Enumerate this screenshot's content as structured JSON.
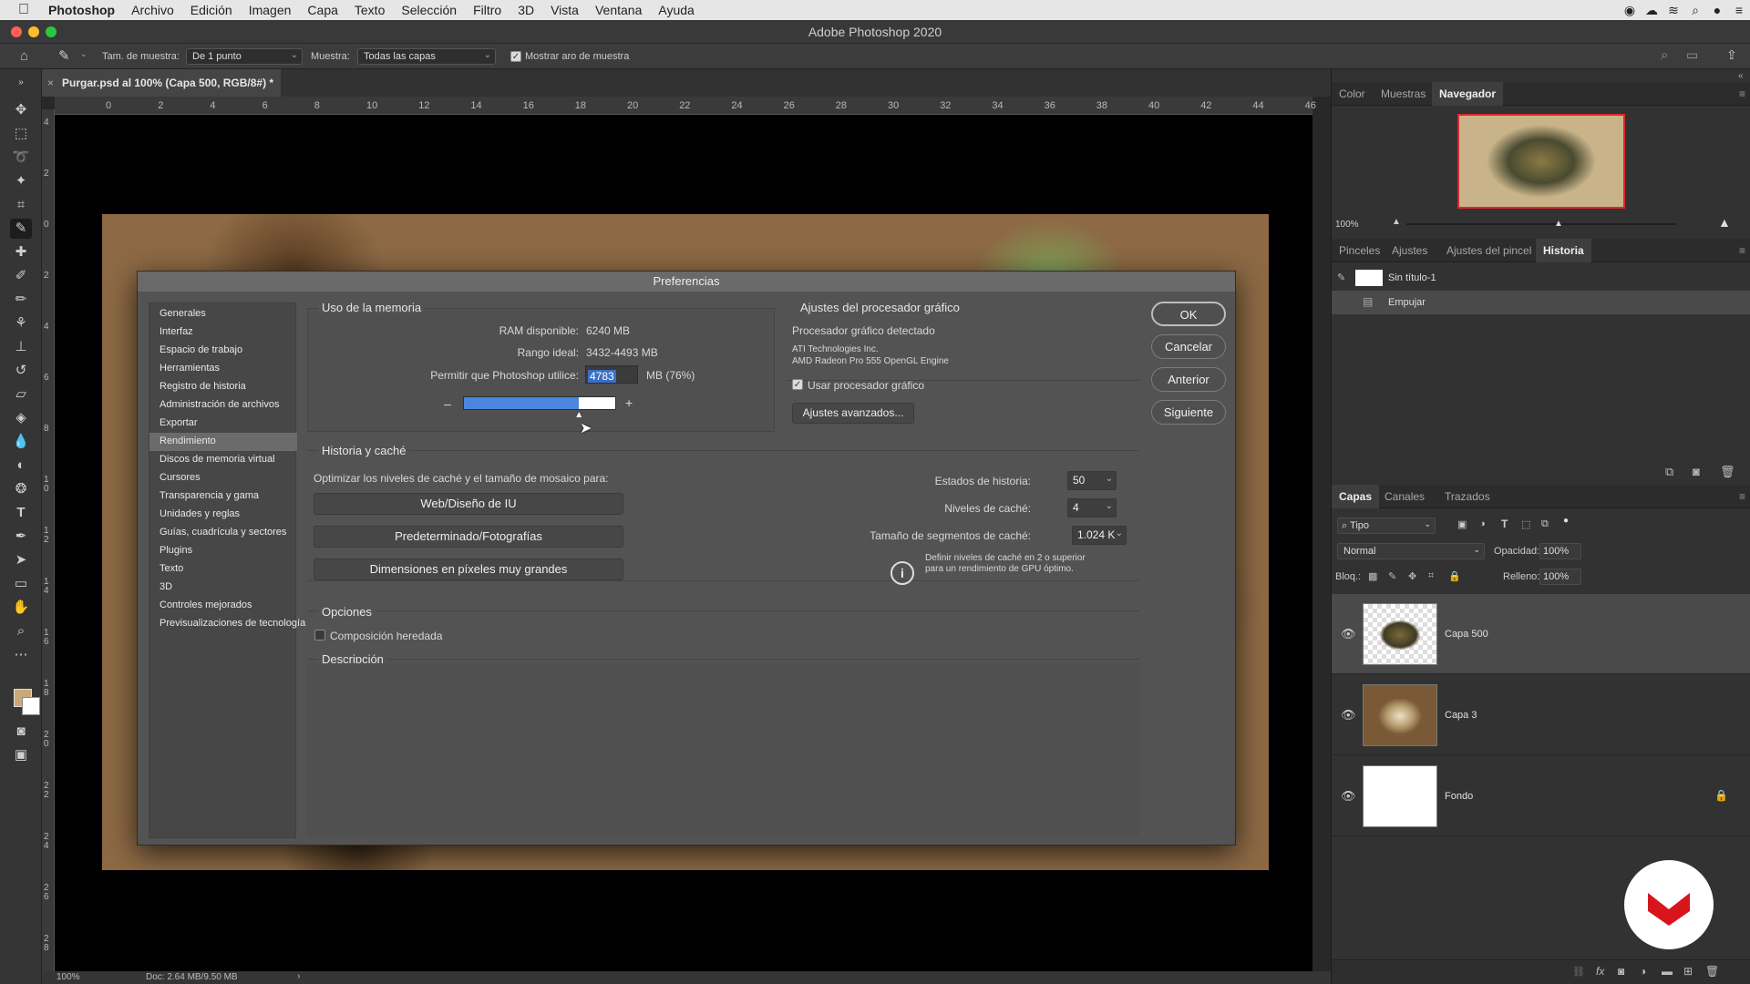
{
  "menubar": {
    "app": "Photoshop",
    "items": [
      "Archivo",
      "Edición",
      "Imagen",
      "Capa",
      "Texto",
      "Selección",
      "Filtro",
      "3D",
      "Vista",
      "Ventana",
      "Ayuda"
    ]
  },
  "window": {
    "title": "Adobe Photoshop 2020"
  },
  "options": {
    "sample_size_label": "Tam. de muestra:",
    "sample_size_value": "De 1 punto",
    "sample_label": "Muestra:",
    "sample_value": "Todas las capas",
    "show_ring_label": "Mostrar aro de muestra"
  },
  "document": {
    "tab": "Purgar.psd al 100% (Capa 500, RGB/8#) *",
    "ruler_h": [
      "0",
      "2",
      "4",
      "6",
      "8",
      "10",
      "12",
      "14",
      "16",
      "18",
      "20",
      "22",
      "24",
      "26",
      "28",
      "30",
      "32",
      "34",
      "36",
      "38",
      "40",
      "42",
      "44",
      "46"
    ],
    "ruler_v": [
      "4",
      "2",
      "0",
      "2",
      "4",
      "6",
      "8",
      "1 0",
      "1 2",
      "1 4",
      "1 6",
      "1 8",
      "2 0",
      "2 2",
      "2 4",
      "2 6",
      "2 8"
    ],
    "zoom": "100%",
    "doc_info": "Doc: 2.64 MB/9.50 MB"
  },
  "dialog": {
    "title": "Preferencias",
    "nav": [
      "Generales",
      "Interfaz",
      "Espacio de trabajo",
      "Herramientas",
      "Registro de historia",
      "Administración de archivos",
      "Exportar",
      "Rendimiento",
      "Discos de memoria virtual",
      "Cursores",
      "Transparencia y gama",
      "Unidades y reglas",
      "Guías, cuadrícula y sectores",
      "Plugins",
      "Texto",
      "3D",
      "Controles mejorados",
      "Previsualizaciones de tecnología"
    ],
    "selected_nav": "Rendimiento",
    "memory": {
      "title": "Uso de la memoria",
      "ram_label": "RAM disponible:",
      "ram_value": "6240 MB",
      "ideal_label": "Rango ideal:",
      "ideal_value": "3432-4493 MB",
      "allow_label": "Permitir que Photoshop utilice:",
      "allow_value": "4783",
      "allow_unit": "MB (76%)",
      "slider_fraction": 0.76,
      "minus": "–",
      "plus": "+"
    },
    "gpu": {
      "title": "Ajustes del procesador gráfico",
      "detected_label": "Procesador gráfico detectado",
      "vendor": "ATI Technologies Inc.",
      "engine": "AMD Radeon Pro 555 OpenGL Engine",
      "use_gpu_label": "Usar procesador gráfico",
      "advanced_button": "Ajustes avanzados..."
    },
    "history": {
      "title": "Historia y caché",
      "optimize_label": "Optimizar los niveles de caché y el tamaño de mosaico para:",
      "buttons": [
        "Web/Diseño de IU",
        "Predeterminado/Fotografías",
        "Dimensiones en píxeles muy grandes"
      ],
      "states_label": "Estados de historia:",
      "states_value": "50",
      "levels_label": "Niveles de caché:",
      "levels_value": "4",
      "tile_label": "Tamaño de segmentos de caché:",
      "tile_value": "1.024 K",
      "info": "Definir niveles de caché en 2 o superior para un rendimiento de GPU óptimo."
    },
    "options": {
      "title": "Opciones",
      "legacy_label": "Composición heredada"
    },
    "description": {
      "title": "Descripción"
    },
    "buttons": {
      "ok": "OK",
      "cancel": "Cancelar",
      "prev": "Anterior",
      "next": "Siguiente"
    }
  },
  "panels": {
    "top_tabs": [
      "Color",
      "Muestras",
      "Navegador"
    ],
    "nav_zoom": "100%",
    "mid_tabs": [
      "Pinceles",
      "Ajustes",
      "Ajustes del pincel",
      "Historia"
    ],
    "history_items": [
      "Sin título-1",
      "Empujar"
    ],
    "layer_tabs": [
      "Capas",
      "Canales",
      "Trazados"
    ],
    "layer_filter": "Tipo",
    "blend_mode": "Normal",
    "opacity_label": "Opacidad:",
    "opacity_value": "100%",
    "lock_label": "Bloq.:",
    "fill_label": "Relleno:",
    "fill_value": "100%",
    "layers": [
      "Capa 500",
      "Capa 3",
      "Fondo"
    ]
  }
}
